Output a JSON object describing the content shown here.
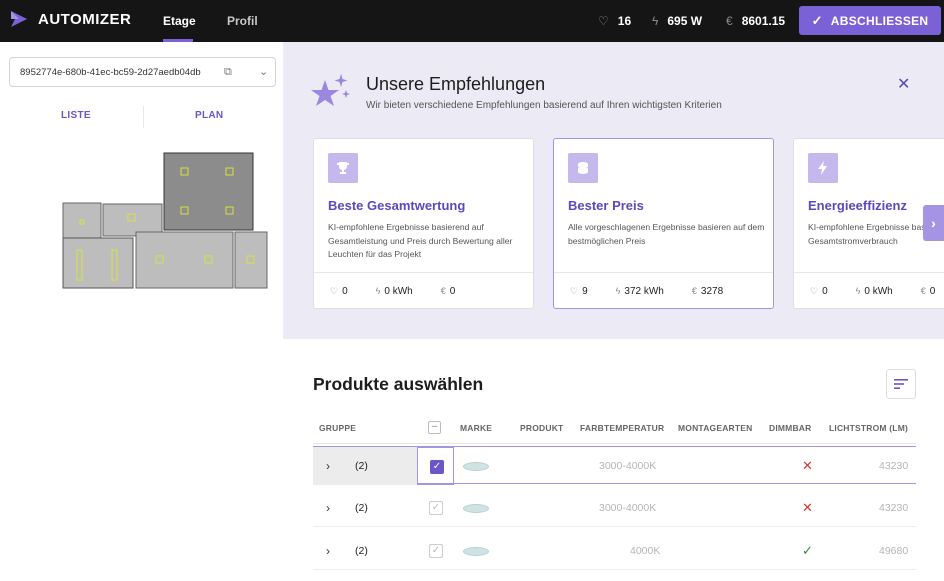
{
  "app": {
    "name": "AUTOMIZER"
  },
  "nav": {
    "tabs": [
      {
        "label": "Etage"
      },
      {
        "label": "Profil"
      }
    ]
  },
  "stats": {
    "lights": "16",
    "power": "695 W",
    "price": "8601.15"
  },
  "actions": {
    "finish_label": "ABSCHLIESSEN"
  },
  "floor": {
    "id": "8952774e-680b-41ec-bc59-2d27aedb04db",
    "views": [
      {
        "label": "LISTE"
      },
      {
        "label": "PLAN"
      }
    ]
  },
  "recommendations": {
    "title": "Unsere Empfehlungen",
    "subtitle": "Wir bieten verschiedene Empfehlungen basierend auf Ihren wichtigsten Kriterien",
    "cards": [
      {
        "title": "Beste Gesamtwertung",
        "icon": "trophy-icon",
        "description": "KI-empfohlene Ergebnisse basierend auf Gesamtleistung und Preis durch Bewertung aller Leuchten für das Projekt",
        "count": "0",
        "energy": "0 kWh",
        "price": "0"
      },
      {
        "title": "Bester Preis",
        "icon": "coins-icon",
        "description": "Alle vorgeschlagenen Ergebnisse basieren auf dem bestmöglichen Preis",
        "count": "9",
        "energy": "372 kWh",
        "price": "3278"
      },
      {
        "title": "Energieeffizienz",
        "icon": "lightning-icon",
        "description": "KI-empfohlene Ergebnisse basierend auf dem Gesamtstromverbrauch",
        "count": "0",
        "energy": "0 kWh",
        "price": "0"
      }
    ]
  },
  "products": {
    "title": "Produkte auswählen",
    "columns": {
      "gruppe": "GRUPPE",
      "marke": "MARKE",
      "produkt": "PRODUKT",
      "farbtemperatur": "FARBTEMPERATUR",
      "montagearten": "MONTAGEARTEN",
      "dimmbar": "DIMMBAR",
      "lichtstrom": "LICHTSTROM (LM)"
    },
    "rows": [
      {
        "count": "(2)",
        "farbtemperatur": "3000-4000K",
        "dimmbar": "✕",
        "lichtstrom": "43230",
        "selected": true
      },
      {
        "count": "(2)",
        "farbtemperatur": "3000-4000K",
        "dimmbar": "✕",
        "lichtstrom": "43230",
        "selected": false
      },
      {
        "count": "(2)",
        "farbtemperatur": "4000K",
        "dimmbar": "✓",
        "lichtstrom": "49680",
        "selected": false
      }
    ]
  },
  "colors": {
    "accent": "#7b61d6",
    "no": "#d9362e",
    "yes": "#2e8b3a"
  }
}
